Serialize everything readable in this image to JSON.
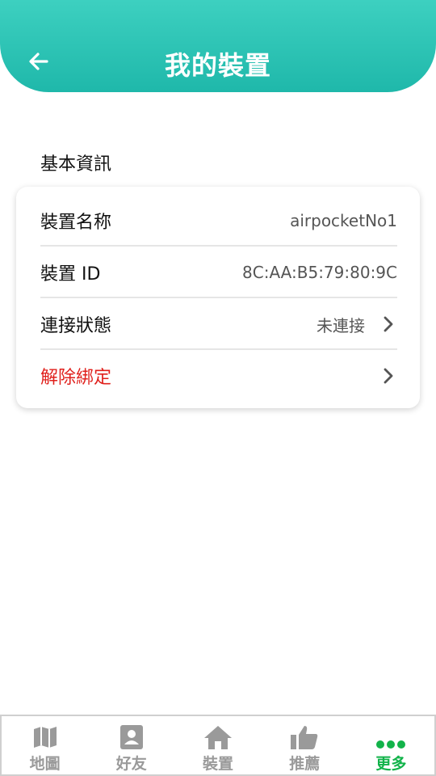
{
  "header": {
    "title": "我的裝置",
    "back_icon": "arrow-left-icon"
  },
  "section": {
    "title": "基本資訊"
  },
  "device": {
    "name_label": "裝置名称",
    "name_value": "airpocketNo1",
    "id_label": "裝置 ID",
    "id_value": "8C:AA:B5:79:80:9C",
    "status_label": "連接狀態",
    "status_value": "未連接",
    "unbind_label": "解除綁定"
  },
  "tabs": [
    {
      "label": "地圖",
      "icon": "map-icon"
    },
    {
      "label": "好友",
      "icon": "contact-icon"
    },
    {
      "label": "裝置",
      "icon": "home-icon"
    },
    {
      "label": "推薦",
      "icon": "thumb-up-icon"
    },
    {
      "label": "更多",
      "icon": "more-dots-icon",
      "active": true
    }
  ],
  "colors": {
    "accent": "#1fb8aa",
    "danger": "#e0201c",
    "active_tab": "#12b34a",
    "inactive_tab": "#9a9a9a"
  }
}
